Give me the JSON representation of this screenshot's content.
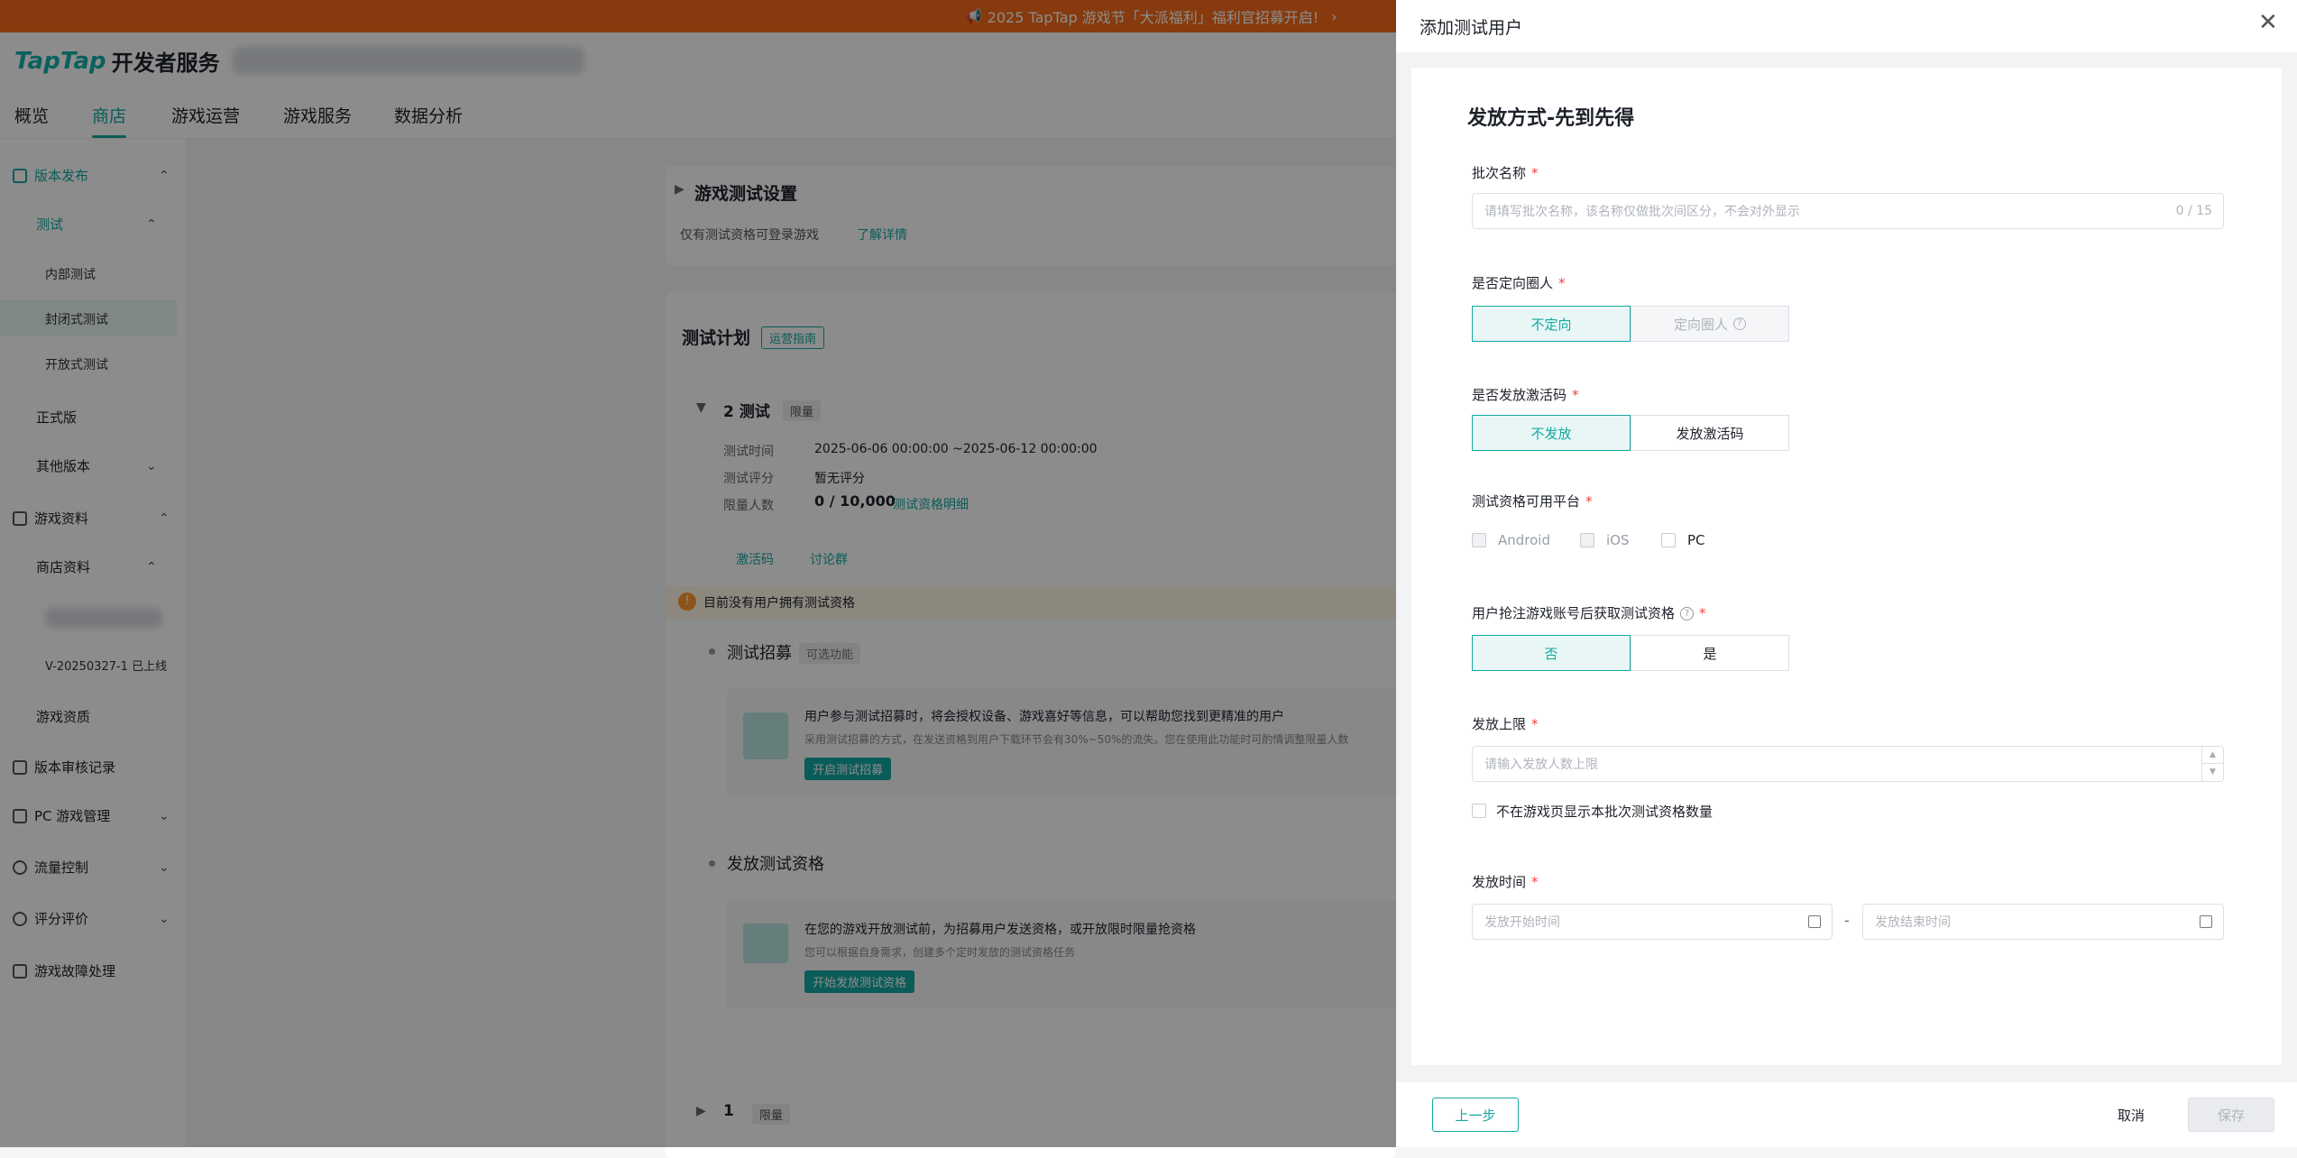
{
  "banner": {
    "text": "2025 TapTap 游戏节「大派福利」福利官招募开启!",
    "chevron": "›"
  },
  "header": {
    "logo_latin": "TapTap",
    "logo_cn": "开发者服务"
  },
  "nav": {
    "tabs": [
      "概览",
      "商店",
      "游戏运营",
      "游戏服务",
      "数据分析"
    ]
  },
  "sidebar": {
    "items": [
      "版本发布",
      "测试",
      "内部测试",
      "封闭式测试",
      "开放式测试",
      "正式版",
      "其他版本",
      "游戏资料",
      "商店资料",
      "V-20250327-1 已上线",
      "游戏资质",
      "版本审核记录",
      "PC 游戏管理",
      "流量控制",
      "评分评价",
      "游戏故障处理"
    ]
  },
  "main": {
    "section_title": "游戏测试设置",
    "section_sub": "仅有测试资格可登录游戏",
    "learn_more": "了解详情",
    "plan_title": "测试计划",
    "plan_guide": "运营指南",
    "test_name": "2 测试",
    "test_tag": "限量",
    "time_label": "测试时间",
    "time_value": "2025-06-06 00:00:00 ~2025-06-12 00:00:00",
    "score_label": "测试评分",
    "score_value": "暂无评分",
    "limit_label": "限量人数",
    "limit_value": "0 / 10,000",
    "limit_link": "测试资格明细",
    "tab_code": "激活码",
    "tab_group": "讨论群",
    "warning": "目前没有用户拥有测试资格",
    "recruit_title": "测试招募",
    "recruit_tag": "可选功能",
    "recruit_desc1": "用户参与测试招募时，将会授权设备、游戏喜好等信息，可以帮助您找到更精准的用户",
    "recruit_desc2": "采用测试招募的方式，在发送资格到用户下载环节会有30%~50%的流失。您在使用此功能时可酌情调整限量人数",
    "recruit_btn": "开启测试招募",
    "issue_title": "发放测试资格",
    "issue_desc1": "在您的游戏开放测试前，为招募用户发送资格，或开放限时限量抢资格",
    "issue_desc2": "您可以根据自身需求，创建多个定时发放的测试资格任务",
    "issue_btn": "开始发放测试资格",
    "test2_name": "1",
    "test2_tag": "限量"
  },
  "drawer": {
    "title": "添加测试用户",
    "form_title": "发放方式-先到先得",
    "batch_label": "批次名称",
    "batch_placeholder": "请填写批次名称，该名称仅做批次间区分，不会对外显示",
    "batch_count": "0 / 15",
    "target_label": "是否定向圈人",
    "target_opt1": "不定向",
    "target_opt2": "定向圈人",
    "code_label": "是否发放激活码",
    "code_opt1": "不发放",
    "code_opt2": "发放激活码",
    "platform_label": "测试资格可用平台",
    "platforms": [
      "Android",
      "iOS",
      "PC"
    ],
    "follow_label": "用户抢注游戏账号后获取测试资格",
    "follow_opt1": "否",
    "follow_opt2": "是",
    "limit_label": "发放上限",
    "limit_placeholder": "请输入发放人数上限",
    "hide_count": "不在游戏页显示本批次测试资格数量",
    "time_label": "发放时间",
    "start_placeholder": "发放开始时间",
    "end_placeholder": "发放结束时间",
    "range_sep": "-",
    "prev_btn": "上一步",
    "cancel_btn": "取消",
    "save_btn": "保存",
    "required_mark": "*"
  },
  "colors": {
    "accent": "#13a8a0",
    "banner": "#f56a19",
    "required": "#f53f3f"
  }
}
